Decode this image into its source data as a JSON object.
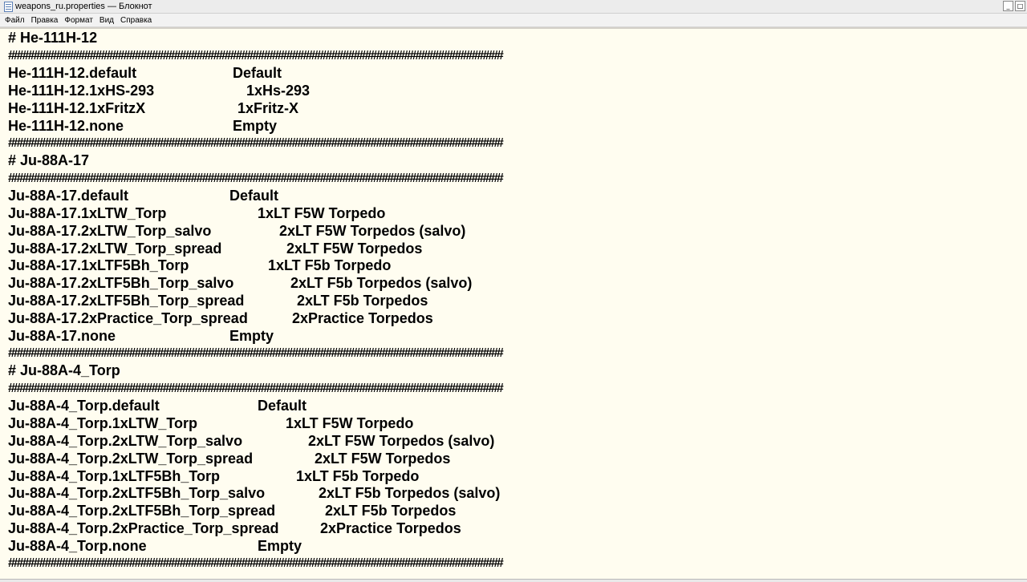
{
  "window": {
    "title": "weapons_ru.properties — Блокнот",
    "buttons": [
      "_",
      "□"
    ]
  },
  "menu": [
    "Файл",
    "Правка",
    "Формат",
    "Вид",
    "Справка"
  ],
  "editor": {
    "hash": "########################################################################################",
    "lines": [
      {
        "type": "text",
        "text": "# He-111H-12"
      },
      {
        "type": "hash"
      },
      {
        "type": "kv",
        "key": "He-111H-12.default",
        "value": "Default"
      },
      {
        "type": "kv",
        "key": "He-111H-12.1xHS-293",
        "value": "1xHs-293"
      },
      {
        "type": "kv",
        "key": "He-111H-12.1xFritzX",
        "value": "1xFritz-X"
      },
      {
        "type": "kv",
        "key": "He-111H-12.none",
        "value": "Empty"
      },
      {
        "type": "hash"
      },
      {
        "type": "text",
        "text": "# Ju-88A-17"
      },
      {
        "type": "hash"
      },
      {
        "type": "kv",
        "key": "Ju-88A-17.default",
        "value": "Default"
      },
      {
        "type": "kv",
        "key": "Ju-88A-17.1xLTW_Torp",
        "value": "1xLT F5W Torpedo"
      },
      {
        "type": "kv",
        "key": "Ju-88A-17.2xLTW_Torp_salvo",
        "value": "2xLT F5W Torpedos (salvo)"
      },
      {
        "type": "kv",
        "key": "Ju-88A-17.2xLTW_Torp_spread",
        "value": "2xLT F5W Torpedos"
      },
      {
        "type": "kv",
        "key": "Ju-88A-17.1xLTF5Bh_Torp",
        "value": "1xLT F5b Torpedo"
      },
      {
        "type": "kv",
        "key": "Ju-88A-17.2xLTF5Bh_Torp_salvo",
        "value": "2xLT F5b Torpedos (salvo)"
      },
      {
        "type": "kv",
        "key": "Ju-88A-17.2xLTF5Bh_Torp_spread",
        "value": "2xLT F5b Torpedos"
      },
      {
        "type": "kv",
        "key": "Ju-88A-17.2xPractice_Torp_spread",
        "value": "2xPractice Torpedos"
      },
      {
        "type": "kv",
        "key": "Ju-88A-17.none",
        "value": "Empty"
      },
      {
        "type": "hash"
      },
      {
        "type": "text",
        "text": "# Ju-88A-4_Torp"
      },
      {
        "type": "hash"
      },
      {
        "type": "kv",
        "key": "Ju-88A-4_Torp.default",
        "value": "Default"
      },
      {
        "type": "kv",
        "key": "Ju-88A-4_Torp.1xLTW_Torp",
        "value": "1xLT F5W Torpedo"
      },
      {
        "type": "kv",
        "key": "Ju-88A-4_Torp.2xLTW_Torp_salvo",
        "value": "2xLT F5W Torpedos (salvo)"
      },
      {
        "type": "kv",
        "key": "Ju-88A-4_Torp.2xLTW_Torp_spread",
        "value": "2xLT F5W Torpedos"
      },
      {
        "type": "kv",
        "key": "Ju-88A-4_Torp.1xLTF5Bh_Torp",
        "value": "1xLT F5b Torpedo"
      },
      {
        "type": "kv",
        "key": "Ju-88A-4_Torp.2xLTF5Bh_Torp_salvo",
        "value": "2xLT F5b Torpedos (salvo)"
      },
      {
        "type": "kv",
        "key": "Ju-88A-4_Torp.2xLTF5Bh_Torp_spread",
        "value": "2xLT F5b Torpedos"
      },
      {
        "type": "kv",
        "key": "Ju-88A-4_Torp.2xPractice_Torp_spread",
        "value": "2xPractice Torpedos"
      },
      {
        "type": "kv",
        "key": "Ju-88A-4_Torp.none",
        "value": "Empty"
      },
      {
        "type": "hash"
      }
    ]
  }
}
